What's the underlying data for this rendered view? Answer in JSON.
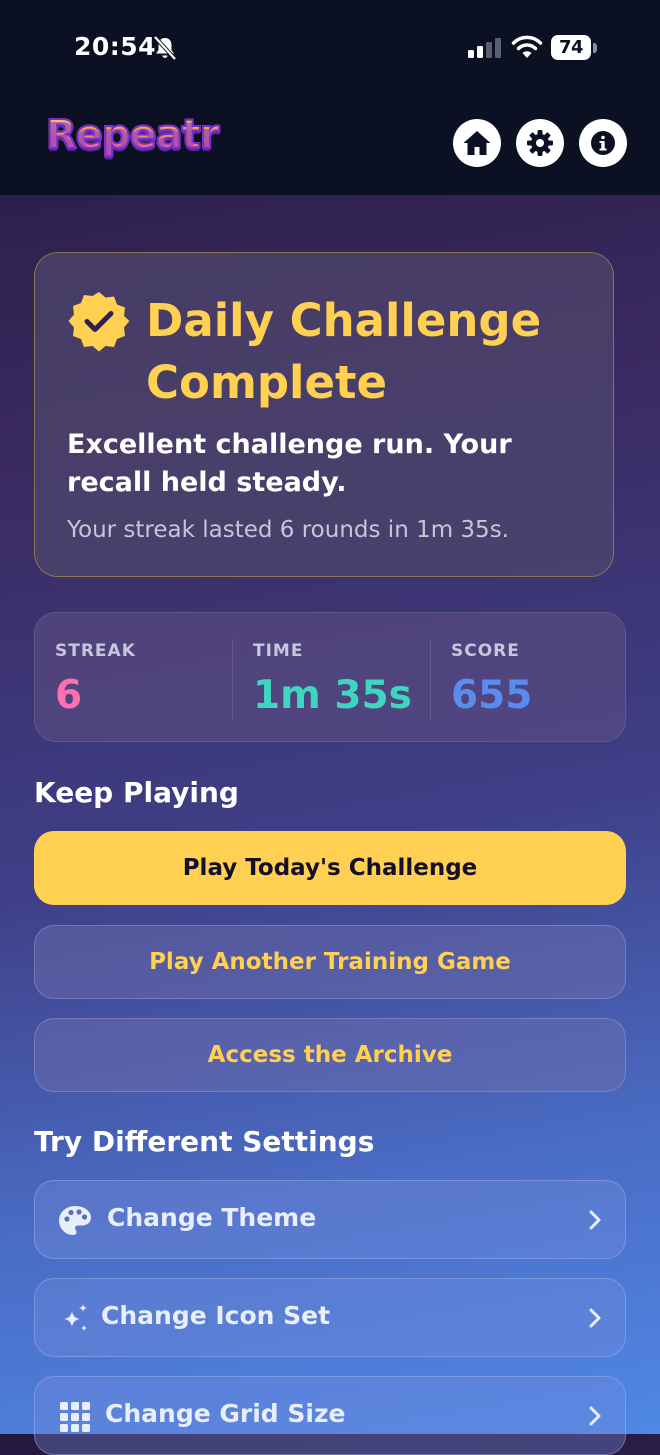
{
  "status_bar": {
    "time": "20:54",
    "battery": "74"
  },
  "app": {
    "logo": "Repeatr"
  },
  "nav": [
    {
      "icon": "home-icon"
    },
    {
      "icon": "gear-icon"
    },
    {
      "icon": "info-icon"
    }
  ],
  "result": {
    "title": "Daily Challenge Complete",
    "message": "Excellent challenge run. Your recall held steady.",
    "summary": "Your streak lasted 6 rounds in 1m 35s.",
    "badge_color": "#ffd052"
  },
  "stats": [
    {
      "label": "STREAK",
      "value": "6",
      "color": "#ff6fb0"
    },
    {
      "label": "TIME",
      "value": "1m 35s",
      "color": "#3fd6c0"
    },
    {
      "label": "SCORE",
      "value": "655",
      "color": "#5a8cf0"
    }
  ],
  "keep_playing": {
    "heading": "Keep Playing",
    "buttons": [
      {
        "label": "Play Today's Challenge"
      },
      {
        "label": "Play Another Training Game"
      },
      {
        "label": "Access the Archive"
      }
    ]
  },
  "settings": {
    "heading": "Try Different Settings",
    "items": [
      {
        "label": "Change Theme",
        "icon": "palette-icon"
      },
      {
        "label": "Change Icon Set",
        "icon": "sparkle-icon"
      },
      {
        "label": "Change Grid Size",
        "icon": "grid-icon"
      }
    ]
  },
  "colors": {
    "accent": "#ffd052",
    "topbar": "#0b1022"
  }
}
